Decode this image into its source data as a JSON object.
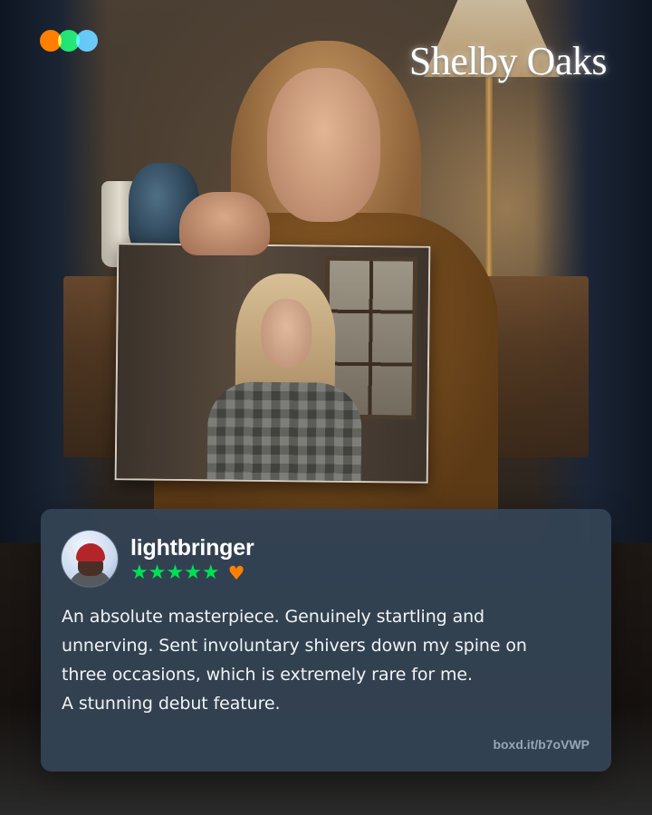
{
  "brand": {
    "logo_icon": "letterboxd-dots-icon",
    "colors": {
      "orange": "#ff8000",
      "green": "#00e054",
      "blue": "#40bcf4"
    }
  },
  "film": {
    "title": "Shelby Oaks"
  },
  "review": {
    "username": "lightbringer",
    "rating_stars": 5,
    "stars_display": "★★★★★",
    "liked": true,
    "heart_display": "♥",
    "text_lines": [
      "An absolute masterpiece. Genuinely startling and",
      "unnerving. Sent involuntary shivers down my spine on",
      "three occasions, which is extremely rare for me.",
      "A stunning debut feature."
    ],
    "short_link": "boxd.it/b7oVWP",
    "card_color": "#344354"
  }
}
